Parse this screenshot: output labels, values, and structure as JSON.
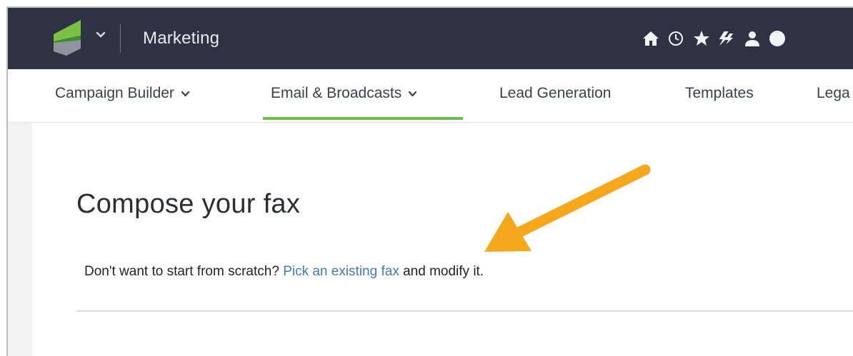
{
  "header": {
    "app_title": "Marketing",
    "icons": [
      "home-icon",
      "clock-icon",
      "star-icon",
      "lightning-icon",
      "user-icon",
      "help-icon"
    ],
    "colors": {
      "background": "#2f3242",
      "logo_green": "#7bc143",
      "logo_dark_green": "#3d8c2f",
      "logo_gray": "#8f949e"
    }
  },
  "nav": {
    "items": [
      {
        "label": "Campaign Builder",
        "has_dropdown": true
      },
      {
        "label": "Email & Broadcasts",
        "has_dropdown": true,
        "active": true
      },
      {
        "label": "Lead Generation",
        "has_dropdown": false
      },
      {
        "label": "Templates",
        "has_dropdown": false
      },
      {
        "label": "Lega",
        "has_dropdown": false
      }
    ],
    "active_color": "#6cbf46"
  },
  "main": {
    "title": "Compose your fax",
    "helper_prefix": "Don't want to start from scratch?",
    "helper_link": "Pick an existing fax",
    "helper_suffix": "and modify it.",
    "link_color": "#3f7bb5"
  },
  "annotation": {
    "arrow_color": "#f5a81c"
  }
}
